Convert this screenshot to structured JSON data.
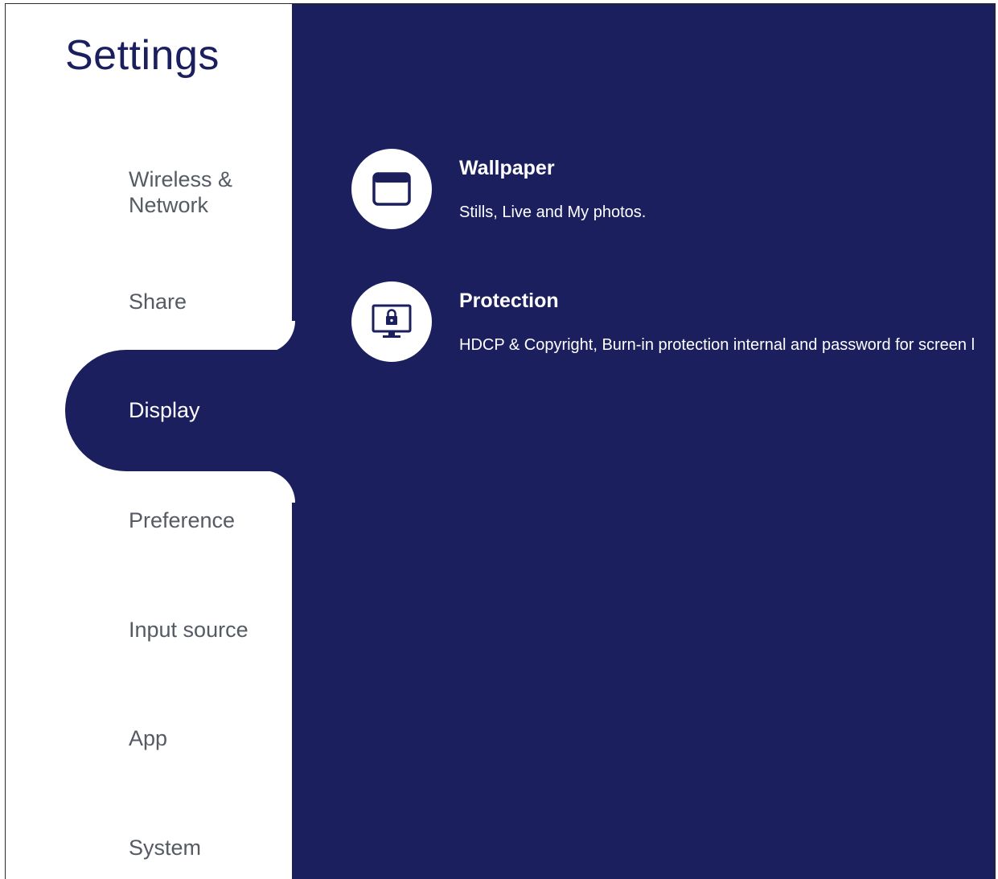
{
  "app": {
    "title": "Settings"
  },
  "sidebar": {
    "items": [
      {
        "label": "Wireless & Network"
      },
      {
        "label": "Share"
      },
      {
        "label": "Display",
        "selected": true
      },
      {
        "label": "Preference"
      },
      {
        "label": "Input source"
      },
      {
        "label": "App"
      },
      {
        "label": "System"
      }
    ]
  },
  "main": {
    "options": [
      {
        "title": "Wallpaper",
        "description": "Stills, Live and My photos.",
        "icon": "wallpaper-icon"
      },
      {
        "title": "Protection",
        "description": "HDCP & Copyright, Burn-in protection internal and password for screen l",
        "icon": "monitor-lock-icon"
      }
    ]
  },
  "colors": {
    "accent": "#1b1f5e",
    "nav_text": "#555a63",
    "background": "#ffffff"
  }
}
